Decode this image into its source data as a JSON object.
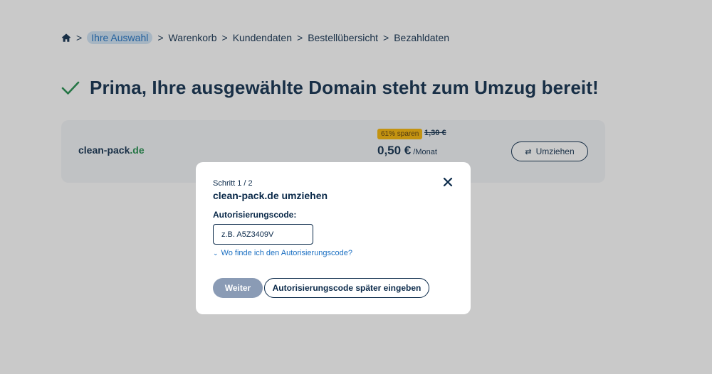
{
  "breadcrumb": {
    "home_icon": "home-icon",
    "items": [
      "Ihre Auswahl",
      "Warenkorb",
      "Kundendaten",
      "Bestellübersicht",
      "Bezahldaten"
    ],
    "separator": ">"
  },
  "success": {
    "icon": "check-icon",
    "title": "Prima, Ihre ausgewählte Domain steht zum Umzug bereit!"
  },
  "domain": {
    "name": "clean-pack",
    "tld": ".de",
    "save_badge": "61% sparen",
    "old_price": "1,30 €",
    "price": "0,50 €",
    "price_unit": "/Monat",
    "move_label": "Umziehen"
  },
  "modal": {
    "step": "Schritt 1 / 2",
    "title": "clean-pack.de umziehen",
    "field_label": "Autorisierungscode:",
    "input_placeholder": "z.B. A5Z3409V",
    "input_value": "",
    "help_link": "Wo finde ich den Autorisierungscode?",
    "next_label": "Weiter",
    "later_label": "Autorisierungscode später eingeben"
  },
  "colors": {
    "accent": "#1a6fc2",
    "navy": "#0b2a4a",
    "success": "#1e8c4a",
    "badge": "#f7b500",
    "disabled_button": "#8a9bb5"
  }
}
